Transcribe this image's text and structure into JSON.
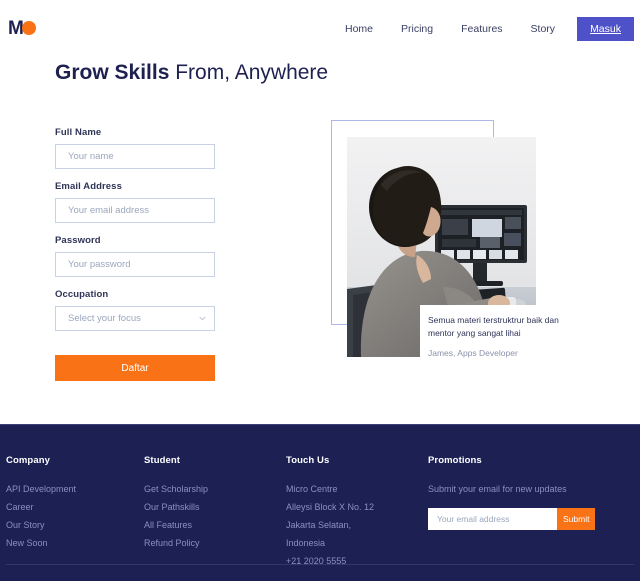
{
  "header": {
    "brand": {
      "letter": "M",
      "mark": "orange-circle"
    },
    "nav": [
      {
        "label": "Home"
      },
      {
        "label": "Pricing"
      },
      {
        "label": "Features"
      },
      {
        "label": "Story"
      }
    ],
    "cta_label": "Masuk"
  },
  "hero": {
    "title_bold": "Grow Skills",
    "title_rest": " From, Anywhere",
    "form": {
      "fields": [
        {
          "label": "Full Name",
          "placeholder": "Your name",
          "value": ""
        },
        {
          "label": "Email Address",
          "placeholder": "Your email address",
          "value": ""
        },
        {
          "label": "Password",
          "placeholder": "Your password",
          "value": ""
        }
      ],
      "occupation": {
        "label": "Occupation",
        "selected": "Select your focus",
        "icon": "chevron-down-icon"
      },
      "submit_label": "Daftar"
    },
    "testimonial": {
      "quote": "Semua materi terstruktrur baik dan mentor yang sangat lihai",
      "author": "James, Apps Developer"
    }
  },
  "footer": {
    "columns": [
      {
        "title": "Company",
        "items": [
          "API Development",
          "Career",
          "Our Story",
          "New Soon"
        ]
      },
      {
        "title": "Student",
        "items": [
          "Get Scholarship",
          "Our Pathskills",
          "All Features",
          "Refund Policy"
        ]
      },
      {
        "title": "Touch Us",
        "items": [
          "Micro Centre",
          "Alleysi Block X No. 12",
          "Jakarta Selatan,",
          "Indonesia",
          "+21 2020 5555"
        ]
      }
    ],
    "promotions": {
      "title": "Promotions",
      "description": "Submit your email for new updates",
      "input_placeholder": "Your email address",
      "input_value": "",
      "submit_label": "Submit"
    }
  },
  "colors": {
    "accent_orange": "#f97316",
    "accent_indigo": "#4f51c9",
    "navy": "#1c2053",
    "frame_blue": "#aeb8e8"
  }
}
